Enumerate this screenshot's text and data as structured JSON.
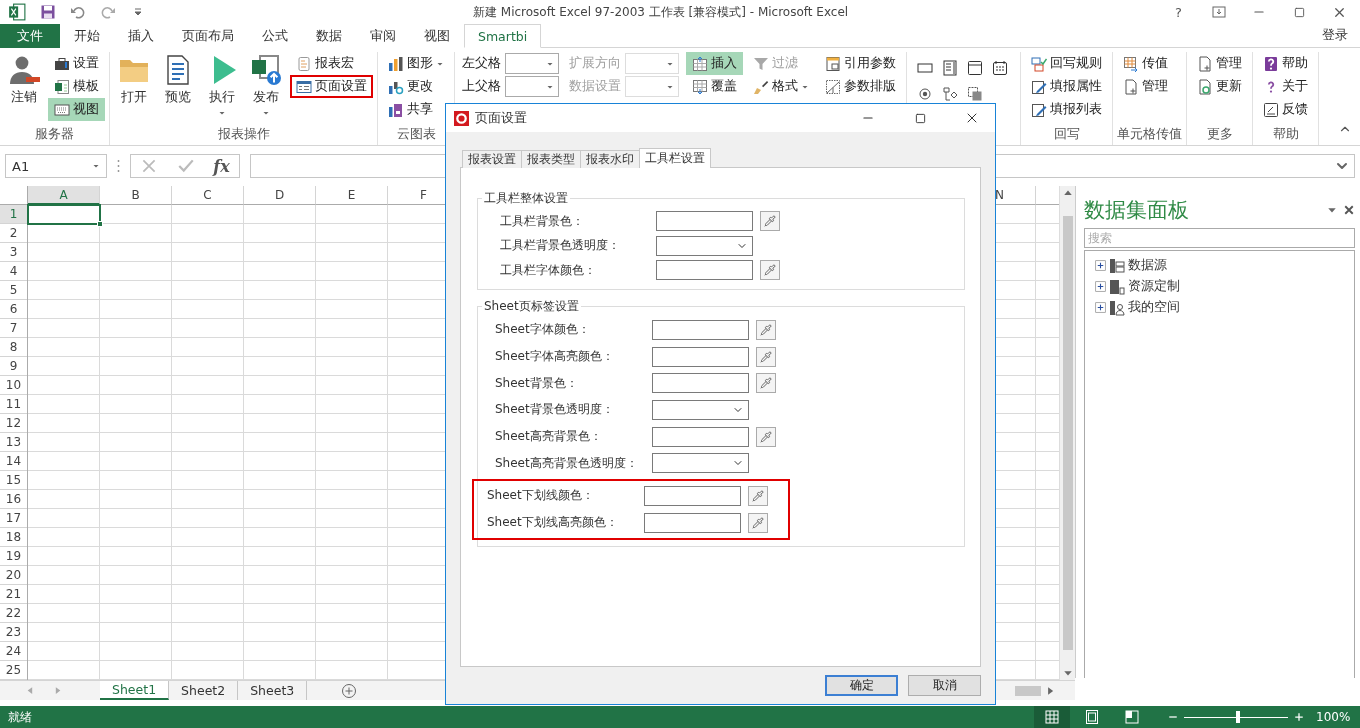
{
  "title_bar": {
    "title": "新建 Microsoft Excel 97-2003 工作表  [兼容模式] - Microsoft Excel",
    "help": "?"
  },
  "ribbon_tabs": [
    {
      "label": "文件",
      "kind": "file",
      "selected": false
    },
    {
      "label": "开始",
      "kind": "tab",
      "selected": false
    },
    {
      "label": "插入",
      "kind": "tab",
      "selected": false
    },
    {
      "label": "页面布局",
      "kind": "tab",
      "selected": false
    },
    {
      "label": "公式",
      "kind": "tab",
      "selected": false
    },
    {
      "label": "数据",
      "kind": "tab",
      "selected": false
    },
    {
      "label": "审阅",
      "kind": "tab",
      "selected": false
    },
    {
      "label": "视图",
      "kind": "tab",
      "selected": false
    },
    {
      "label": "Smartbi",
      "kind": "tab",
      "selected": true
    }
  ],
  "account": "登录",
  "ribbon_groups": [
    {
      "kind": "buttons",
      "label": "服务器",
      "columns": [
        [
          {
            "kind": "large",
            "label": "注销",
            "selected": false
          }
        ],
        [
          {
            "kind": "small",
            "label": "设置",
            "selected": false
          },
          {
            "kind": "small",
            "label": "模板",
            "selected": false
          },
          {
            "kind": "small",
            "label": "视图",
            "selected": true
          }
        ]
      ]
    },
    {
      "kind": "buttons",
      "label": "报表操作",
      "columns": [
        [
          {
            "kind": "large",
            "label": "打开",
            "selected": false
          }
        ],
        [
          {
            "kind": "large",
            "label": "预览",
            "selected": false
          }
        ],
        [
          {
            "kind": "large",
            "label": "执行",
            "selected": false,
            "dropdown": true
          }
        ],
        [
          {
            "kind": "large",
            "label": "发布",
            "selected": false,
            "dropdown": true
          }
        ],
        [
          {
            "kind": "small",
            "label": "报表宏",
            "selected": false,
            "highlighted": false
          },
          {
            "kind": "small",
            "label": "页面设置",
            "selected": false,
            "highlighted": true
          }
        ]
      ]
    },
    {
      "kind": "buttons",
      "label": "云图表",
      "columns": [
        [
          {
            "kind": "small",
            "label": "图形",
            "selected": false,
            "dropdown": true
          },
          {
            "kind": "small",
            "label": "更改",
            "selected": false
          },
          {
            "kind": "small",
            "label": "共享",
            "selected": false
          }
        ]
      ]
    },
    {
      "kind": "buttons",
      "columns": [
        [
          {
            "kind": "combo",
            "label": "左父格",
            "disabled": false
          },
          {
            "kind": "combo",
            "label": "上父格",
            "disabled": false
          }
        ],
        [
          {
            "kind": "combo",
            "label": "扩展方向",
            "disabled": true
          },
          {
            "kind": "combo",
            "label": "数据设置",
            "disabled": true
          }
        ],
        [
          {
            "kind": "small",
            "label": "插入",
            "selected": true
          },
          {
            "kind": "small",
            "label": "覆盖",
            "selected": false
          }
        ],
        [
          {
            "kind": "small",
            "label": "过滤",
            "selected": false,
            "disabled": true
          },
          {
            "kind": "small",
            "label": "格式",
            "selected": false,
            "disabled": false,
            "dropdown": true
          }
        ],
        [
          {
            "kind": "small",
            "label": "引用参数",
            "selected": false
          },
          {
            "kind": "small",
            "label": "参数排版",
            "selected": false
          }
        ]
      ]
    },
    {
      "kind": "icons"
    },
    {
      "kind": "buttons",
      "label": "回写",
      "columns": [
        [
          {
            "kind": "small",
            "label": "回写规则",
            "selected": false
          },
          {
            "kind": "small",
            "label": "填报属性",
            "selected": false
          },
          {
            "kind": "small",
            "label": "填报列表",
            "selected": false
          }
        ]
      ]
    },
    {
      "kind": "buttons",
      "label": "单元格传值",
      "columns": [
        [
          {
            "kind": "small",
            "label": "传值",
            "selected": false
          },
          {
            "kind": "small",
            "label": "管理",
            "selected": false
          }
        ]
      ]
    },
    {
      "kind": "buttons",
      "label": "更多",
      "columns": [
        [
          {
            "kind": "small",
            "label": "管理",
            "selected": false
          },
          {
            "kind": "small",
            "label": "更新",
            "selected": false
          }
        ]
      ]
    },
    {
      "kind": "buttons",
      "label": "帮助",
      "columns": [
        [
          {
            "kind": "small",
            "label": "帮助",
            "selected": false
          },
          {
            "kind": "small",
            "label": "关于",
            "selected": false
          },
          {
            "kind": "small",
            "label": "反馈",
            "selected": false
          }
        ]
      ]
    }
  ],
  "formula_bar": {
    "name_box": "A1",
    "function_button": "fx"
  },
  "columns": [
    {
      "label": "A",
      "selected": true
    },
    {
      "label": "B",
      "selected": false
    },
    {
      "label": "C",
      "selected": false
    },
    {
      "label": "D",
      "selected": false
    },
    {
      "label": "E",
      "selected": false
    },
    {
      "label": "F",
      "selected": false
    },
    {
      "label": "N",
      "selected": false
    }
  ],
  "rows": [
    {
      "label": "1",
      "selected": true
    },
    {
      "label": "2",
      "selected": false
    },
    {
      "label": "3",
      "selected": false
    },
    {
      "label": "4",
      "selected": false
    },
    {
      "label": "5",
      "selected": false
    },
    {
      "label": "6",
      "selected": false
    },
    {
      "label": "7",
      "selected": false
    },
    {
      "label": "8",
      "selected": false
    },
    {
      "label": "9",
      "selected": false
    },
    {
      "label": "10",
      "selected": false
    },
    {
      "label": "11",
      "selected": false
    },
    {
      "label": "12",
      "selected": false
    },
    {
      "label": "13",
      "selected": false
    },
    {
      "label": "14",
      "selected": false
    },
    {
      "label": "15",
      "selected": false
    },
    {
      "label": "16",
      "selected": false
    },
    {
      "label": "17",
      "selected": false
    },
    {
      "label": "18",
      "selected": false
    },
    {
      "label": "19",
      "selected": false
    },
    {
      "label": "20",
      "selected": false
    },
    {
      "label": "21",
      "selected": false
    },
    {
      "label": "22",
      "selected": false
    },
    {
      "label": "23",
      "selected": false
    },
    {
      "label": "24",
      "selected": false
    },
    {
      "label": "25",
      "selected": false
    }
  ],
  "sheet_tabs": [
    {
      "label": "Sheet1",
      "selected": true
    },
    {
      "label": "Sheet2",
      "selected": false
    },
    {
      "label": "Sheet3",
      "selected": false
    }
  ],
  "data_panel": {
    "title": "数据集面板",
    "search": {
      "placeholder": "搜索"
    },
    "tree": [
      {
        "label": "数据源",
        "kind": "datasource",
        "expanded": false
      },
      {
        "label": "资源定制",
        "kind": "resource",
        "expanded": false
      },
      {
        "label": "我的空间",
        "kind": "space",
        "expanded": false
      }
    ]
  },
  "status_bar": {
    "status": "就绪",
    "views": [
      {
        "kind": "normal",
        "selected": true
      },
      {
        "kind": "page_layout",
        "selected": false
      },
      {
        "kind": "page_break",
        "selected": false
      }
    ],
    "zoom": {
      "level": 0.5,
      "reading": "100%"
    }
  },
  "dialog": {
    "title": "页面设置",
    "tabs": [
      {
        "label": "报表设置",
        "selected": false
      },
      {
        "label": "报表类型",
        "selected": false
      },
      {
        "label": "报表水印",
        "selected": false
      },
      {
        "label": "工具栏设置",
        "selected": true
      }
    ],
    "groups": [
      {
        "title": "工具栏整体设置",
        "kind": "toolbar",
        "rows": [
          {
            "label": "工具栏背景色：",
            "kind": "color",
            "highlighted": false
          },
          {
            "label": "工具栏背景色透明度：",
            "kind": "select",
            "highlighted": false
          },
          {
            "label": "工具栏字体颜色：",
            "kind": "color",
            "highlighted": false
          }
        ]
      },
      {
        "title": "Sheet页标签设置",
        "kind": "sheet",
        "rows": [
          {
            "label": "Sheet字体颜色：",
            "kind": "color",
            "highlighted": false
          },
          {
            "label": "Sheet字体高亮颜色：",
            "kind": "color",
            "highlighted": false
          },
          {
            "label": "Sheet背景色：",
            "kind": "color",
            "highlighted": false
          },
          {
            "label": "Sheet背景色透明度：",
            "kind": "select",
            "highlighted": false
          },
          {
            "label": "Sheet高亮背景色：",
            "kind": "color",
            "highlighted": false
          },
          {
            "label": "Sheet高亮背景色透明度：",
            "kind": "select",
            "highlighted": false
          },
          {
            "label": "Sheet下划线颜色：",
            "kind": "color",
            "highlighted": true
          },
          {
            "label": "Sheet下划线高亮颜色：",
            "kind": "color",
            "highlighted": true
          }
        ]
      }
    ],
    "buttons": [
      {
        "label": "确定",
        "default": true
      },
      {
        "label": "取消",
        "default": false
      }
    ]
  }
}
